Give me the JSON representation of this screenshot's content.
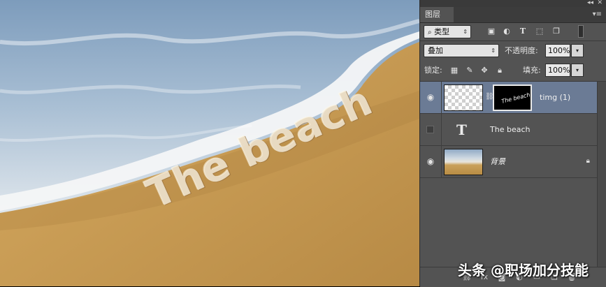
{
  "canvas": {
    "image_text": "The beach"
  },
  "panel": {
    "tab_label": "图层",
    "filter": {
      "selected": "类型"
    },
    "blend_mode": {
      "selected": "叠加"
    },
    "opacity": {
      "label": "不透明度:",
      "value": "100%"
    },
    "lock": {
      "label": "锁定:"
    },
    "fill": {
      "label": "填充:",
      "value": "100%"
    },
    "layers": [
      {
        "name": "timg (1)",
        "visible": true,
        "selected": true,
        "has_mask": true
      },
      {
        "name": "The beach",
        "visible": false,
        "type": "text"
      },
      {
        "name": "背景",
        "visible": true,
        "locked": true
      }
    ],
    "mask_thumb_text": "The beach"
  },
  "watermark": "头条 @职场加分技能",
  "colors": {
    "panel_bg": "#535353",
    "selected_layer": "#6b7b95",
    "tab_bar": "#3c3c3c"
  }
}
